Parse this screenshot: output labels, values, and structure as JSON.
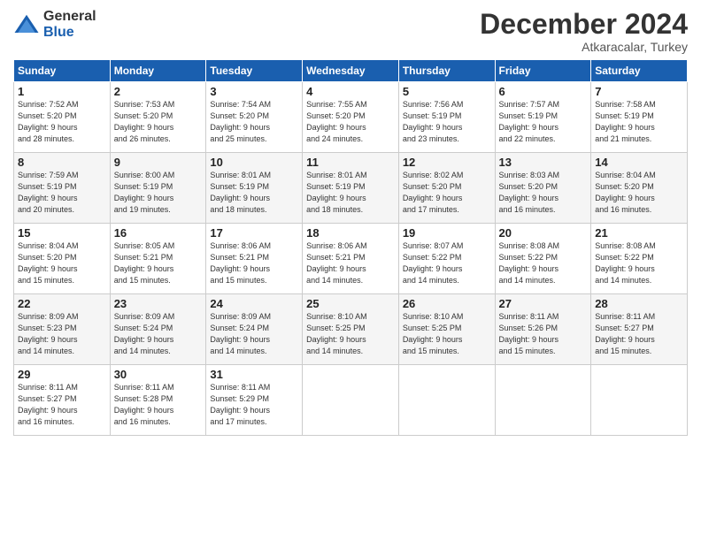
{
  "header": {
    "logo_general": "General",
    "logo_blue": "Blue",
    "month_title": "December 2024",
    "subtitle": "Atkaracalar, Turkey"
  },
  "days_of_week": [
    "Sunday",
    "Monday",
    "Tuesday",
    "Wednesday",
    "Thursday",
    "Friday",
    "Saturday"
  ],
  "weeks": [
    [
      {
        "day": "1",
        "sunrise": "7:52 AM",
        "sunset": "5:20 PM",
        "daylight_hours": "9",
        "daylight_minutes": "28"
      },
      {
        "day": "2",
        "sunrise": "7:53 AM",
        "sunset": "5:20 PM",
        "daylight_hours": "9",
        "daylight_minutes": "26"
      },
      {
        "day": "3",
        "sunrise": "7:54 AM",
        "sunset": "5:20 PM",
        "daylight_hours": "9",
        "daylight_minutes": "25"
      },
      {
        "day": "4",
        "sunrise": "7:55 AM",
        "sunset": "5:20 PM",
        "daylight_hours": "9",
        "daylight_minutes": "24"
      },
      {
        "day": "5",
        "sunrise": "7:56 AM",
        "sunset": "5:19 PM",
        "daylight_hours": "9",
        "daylight_minutes": "23"
      },
      {
        "day": "6",
        "sunrise": "7:57 AM",
        "sunset": "5:19 PM",
        "daylight_hours": "9",
        "daylight_minutes": "22"
      },
      {
        "day": "7",
        "sunrise": "7:58 AM",
        "sunset": "5:19 PM",
        "daylight_hours": "9",
        "daylight_minutes": "21"
      }
    ],
    [
      {
        "day": "8",
        "sunrise": "7:59 AM",
        "sunset": "5:19 PM",
        "daylight_hours": "9",
        "daylight_minutes": "20"
      },
      {
        "day": "9",
        "sunrise": "8:00 AM",
        "sunset": "5:19 PM",
        "daylight_hours": "9",
        "daylight_minutes": "19"
      },
      {
        "day": "10",
        "sunrise": "8:01 AM",
        "sunset": "5:19 PM",
        "daylight_hours": "9",
        "daylight_minutes": "18"
      },
      {
        "day": "11",
        "sunrise": "8:01 AM",
        "sunset": "5:19 PM",
        "daylight_hours": "9",
        "daylight_minutes": "18"
      },
      {
        "day": "12",
        "sunrise": "8:02 AM",
        "sunset": "5:20 PM",
        "daylight_hours": "9",
        "daylight_minutes": "17"
      },
      {
        "day": "13",
        "sunrise": "8:03 AM",
        "sunset": "5:20 PM",
        "daylight_hours": "9",
        "daylight_minutes": "16"
      },
      {
        "day": "14",
        "sunrise": "8:04 AM",
        "sunset": "5:20 PM",
        "daylight_hours": "9",
        "daylight_minutes": "16"
      }
    ],
    [
      {
        "day": "15",
        "sunrise": "8:04 AM",
        "sunset": "5:20 PM",
        "daylight_hours": "9",
        "daylight_minutes": "15"
      },
      {
        "day": "16",
        "sunrise": "8:05 AM",
        "sunset": "5:21 PM",
        "daylight_hours": "9",
        "daylight_minutes": "15"
      },
      {
        "day": "17",
        "sunrise": "8:06 AM",
        "sunset": "5:21 PM",
        "daylight_hours": "9",
        "daylight_minutes": "15"
      },
      {
        "day": "18",
        "sunrise": "8:06 AM",
        "sunset": "5:21 PM",
        "daylight_hours": "9",
        "daylight_minutes": "14"
      },
      {
        "day": "19",
        "sunrise": "8:07 AM",
        "sunset": "5:22 PM",
        "daylight_hours": "9",
        "daylight_minutes": "14"
      },
      {
        "day": "20",
        "sunrise": "8:08 AM",
        "sunset": "5:22 PM",
        "daylight_hours": "9",
        "daylight_minutes": "14"
      },
      {
        "day": "21",
        "sunrise": "8:08 AM",
        "sunset": "5:22 PM",
        "daylight_hours": "9",
        "daylight_minutes": "14"
      }
    ],
    [
      {
        "day": "22",
        "sunrise": "8:09 AM",
        "sunset": "5:23 PM",
        "daylight_hours": "9",
        "daylight_minutes": "14"
      },
      {
        "day": "23",
        "sunrise": "8:09 AM",
        "sunset": "5:24 PM",
        "daylight_hours": "9",
        "daylight_minutes": "14"
      },
      {
        "day": "24",
        "sunrise": "8:09 AM",
        "sunset": "5:24 PM",
        "daylight_hours": "9",
        "daylight_minutes": "14"
      },
      {
        "day": "25",
        "sunrise": "8:10 AM",
        "sunset": "5:25 PM",
        "daylight_hours": "9",
        "daylight_minutes": "14"
      },
      {
        "day": "26",
        "sunrise": "8:10 AM",
        "sunset": "5:25 PM",
        "daylight_hours": "9",
        "daylight_minutes": "15"
      },
      {
        "day": "27",
        "sunrise": "8:11 AM",
        "sunset": "5:26 PM",
        "daylight_hours": "9",
        "daylight_minutes": "15"
      },
      {
        "day": "28",
        "sunrise": "8:11 AM",
        "sunset": "5:27 PM",
        "daylight_hours": "9",
        "daylight_minutes": "15"
      }
    ],
    [
      {
        "day": "29",
        "sunrise": "8:11 AM",
        "sunset": "5:27 PM",
        "daylight_hours": "9",
        "daylight_minutes": "16"
      },
      {
        "day": "30",
        "sunrise": "8:11 AM",
        "sunset": "5:28 PM",
        "daylight_hours": "9",
        "daylight_minutes": "16"
      },
      {
        "day": "31",
        "sunrise": "8:11 AM",
        "sunset": "5:29 PM",
        "daylight_hours": "9",
        "daylight_minutes": "17"
      },
      null,
      null,
      null,
      null
    ]
  ],
  "labels": {
    "sunrise": "Sunrise:",
    "sunset": "Sunset:",
    "daylight": "Daylight: ",
    "hours_suffix": " hours",
    "and": "and ",
    "minutes_suffix": " minutes."
  }
}
